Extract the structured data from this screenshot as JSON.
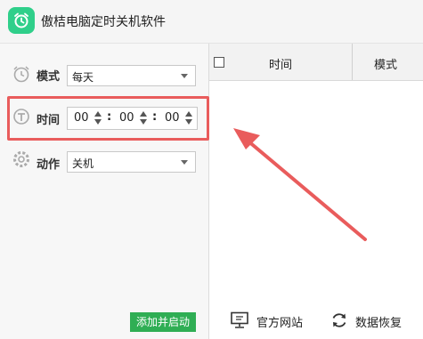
{
  "app": {
    "title": "傲桔电脑定时关机软件"
  },
  "form": {
    "mode": {
      "label": "模式",
      "value": "每天"
    },
    "time": {
      "label": "时间",
      "hour": "00",
      "minute": "00",
      "second": "00",
      "separator": ":"
    },
    "action": {
      "label": "动作",
      "value": "关机"
    },
    "add_button": "添加并启动"
  },
  "table": {
    "columns": [
      "时间",
      "模式"
    ]
  },
  "footer": {
    "website": "官方网站",
    "restore": "数据恢复"
  },
  "colors": {
    "accent_green": "#2fae54",
    "icon_green": "#2fcf8a",
    "annotation_red": "#e95c5c"
  }
}
